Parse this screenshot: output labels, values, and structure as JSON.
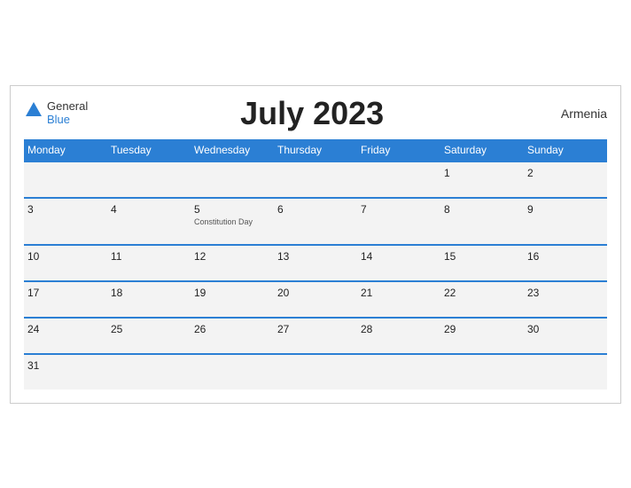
{
  "header": {
    "logo_general": "General",
    "logo_blue": "Blue",
    "title": "July 2023",
    "country": "Armenia"
  },
  "weekdays": [
    "Monday",
    "Tuesday",
    "Wednesday",
    "Thursday",
    "Friday",
    "Saturday",
    "Sunday"
  ],
  "weeks": [
    [
      {
        "day": "",
        "event": ""
      },
      {
        "day": "",
        "event": ""
      },
      {
        "day": "",
        "event": ""
      },
      {
        "day": "",
        "event": ""
      },
      {
        "day": "",
        "event": ""
      },
      {
        "day": "1",
        "event": ""
      },
      {
        "day": "2",
        "event": ""
      }
    ],
    [
      {
        "day": "3",
        "event": ""
      },
      {
        "day": "4",
        "event": ""
      },
      {
        "day": "5",
        "event": "Constitution Day"
      },
      {
        "day": "6",
        "event": ""
      },
      {
        "day": "7",
        "event": ""
      },
      {
        "day": "8",
        "event": ""
      },
      {
        "day": "9",
        "event": ""
      }
    ],
    [
      {
        "day": "10",
        "event": ""
      },
      {
        "day": "11",
        "event": ""
      },
      {
        "day": "12",
        "event": ""
      },
      {
        "day": "13",
        "event": ""
      },
      {
        "day": "14",
        "event": ""
      },
      {
        "day": "15",
        "event": ""
      },
      {
        "day": "16",
        "event": ""
      }
    ],
    [
      {
        "day": "17",
        "event": ""
      },
      {
        "day": "18",
        "event": ""
      },
      {
        "day": "19",
        "event": ""
      },
      {
        "day": "20",
        "event": ""
      },
      {
        "day": "21",
        "event": ""
      },
      {
        "day": "22",
        "event": ""
      },
      {
        "day": "23",
        "event": ""
      }
    ],
    [
      {
        "day": "24",
        "event": ""
      },
      {
        "day": "25",
        "event": ""
      },
      {
        "day": "26",
        "event": ""
      },
      {
        "day": "27",
        "event": ""
      },
      {
        "day": "28",
        "event": ""
      },
      {
        "day": "29",
        "event": ""
      },
      {
        "day": "30",
        "event": ""
      }
    ],
    [
      {
        "day": "31",
        "event": ""
      },
      {
        "day": "",
        "event": ""
      },
      {
        "day": "",
        "event": ""
      },
      {
        "day": "",
        "event": ""
      },
      {
        "day": "",
        "event": ""
      },
      {
        "day": "",
        "event": ""
      },
      {
        "day": "",
        "event": ""
      }
    ]
  ]
}
